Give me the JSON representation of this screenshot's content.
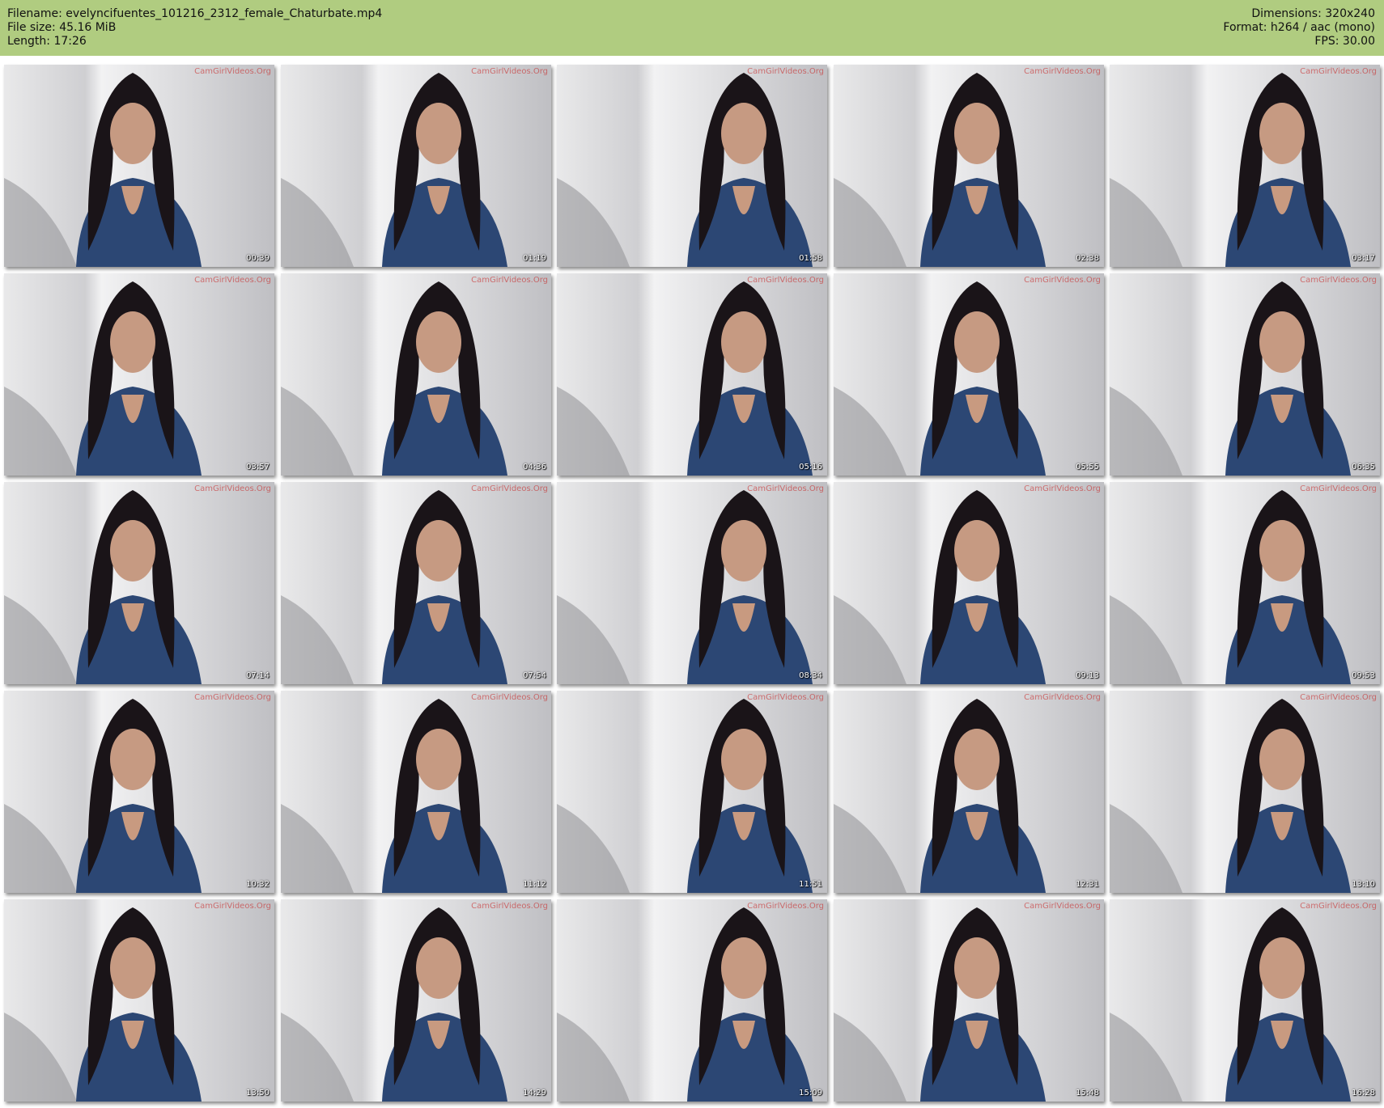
{
  "header": {
    "filename": "Filename: evelyncifuentes_101216_2312_female_Chaturbate.mp4",
    "filesize": "File size: 45.16 MiB",
    "length": "Length: 17:26",
    "dimensions": "Dimensions: 320x240",
    "format": "Format: h264 / aac (mono)",
    "fps": "FPS: 30.00"
  },
  "watermark": "CamGirlVideos.Org",
  "colors": {
    "header_bg": "#b0cc80",
    "shirt": "#2c4774",
    "hair": "#1a1418",
    "wall": "#cfcfd1"
  },
  "thumbnails": [
    {
      "time": "00:39"
    },
    {
      "time": "01:19"
    },
    {
      "time": "01:58"
    },
    {
      "time": "02:38"
    },
    {
      "time": "03:17"
    },
    {
      "time": "03:57"
    },
    {
      "time": "04:36"
    },
    {
      "time": "05:16"
    },
    {
      "time": "05:55"
    },
    {
      "time": "06:35"
    },
    {
      "time": "07:14"
    },
    {
      "time": "07:54"
    },
    {
      "time": "08:34"
    },
    {
      "time": "09:13"
    },
    {
      "time": "09:53"
    },
    {
      "time": "10:32"
    },
    {
      "time": "11:12"
    },
    {
      "time": "11:51"
    },
    {
      "time": "12:31"
    },
    {
      "time": "13:10"
    },
    {
      "time": "13:50"
    },
    {
      "time": "14:29"
    },
    {
      "time": "15:09"
    },
    {
      "time": "15:48"
    },
    {
      "time": "16:28"
    }
  ]
}
